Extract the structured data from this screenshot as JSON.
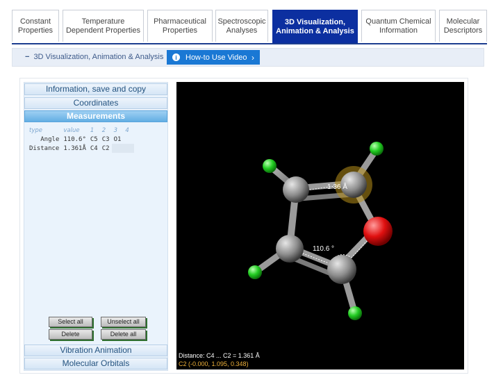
{
  "tabs": [
    {
      "label": "Constant\nProperties"
    },
    {
      "label": "Temperature\nDependent Properties"
    },
    {
      "label": "Pharmaceutical\nProperties"
    },
    {
      "label": "Spectroscopic\nAnalyses"
    },
    {
      "label": "3D Visualization,\nAnimation & Analysis"
    },
    {
      "label": "Quantum Chemical\nInformation"
    },
    {
      "label": "Molecular\nDescriptors"
    }
  ],
  "subheader": {
    "dash": "−",
    "crumb": "3D Visualization, Animation & Analysis",
    "howto_label": "How-to Use Video",
    "howto_icon": "i",
    "chevron": "›"
  },
  "accordion": {
    "info": "Information, save and copy",
    "coords": "Coordinates",
    "measurements": "Measurements",
    "vibration": "Vibration Animation",
    "orbitals": "Molecular Orbitals"
  },
  "measure_table": {
    "headers": [
      "type",
      "value",
      "1",
      "2",
      "3",
      "4"
    ],
    "rows": [
      [
        "Angle",
        "110.6°",
        "C5",
        "C3",
        "O1",
        ""
      ],
      [
        "Distance",
        "1.361Å",
        "C4",
        "C2",
        "",
        ""
      ]
    ]
  },
  "buttons": {
    "select_all": "Select all",
    "unselect_all": "Unselect all",
    "delete": "Delete",
    "delete_all": "Delete all"
  },
  "viewer": {
    "label_distance": "1.36 Å",
    "label_angle": "110.6 °",
    "status_line1": "Distance: C4 ... C2 = 1.361 Å",
    "status_line2": "C2  (-0.000, 1.095, 0.348)"
  },
  "colors": {
    "carbon": "#8c8c8c",
    "hydrogen": "#22cc22",
    "oxygen": "#e01010",
    "selection": "#e0b020"
  }
}
